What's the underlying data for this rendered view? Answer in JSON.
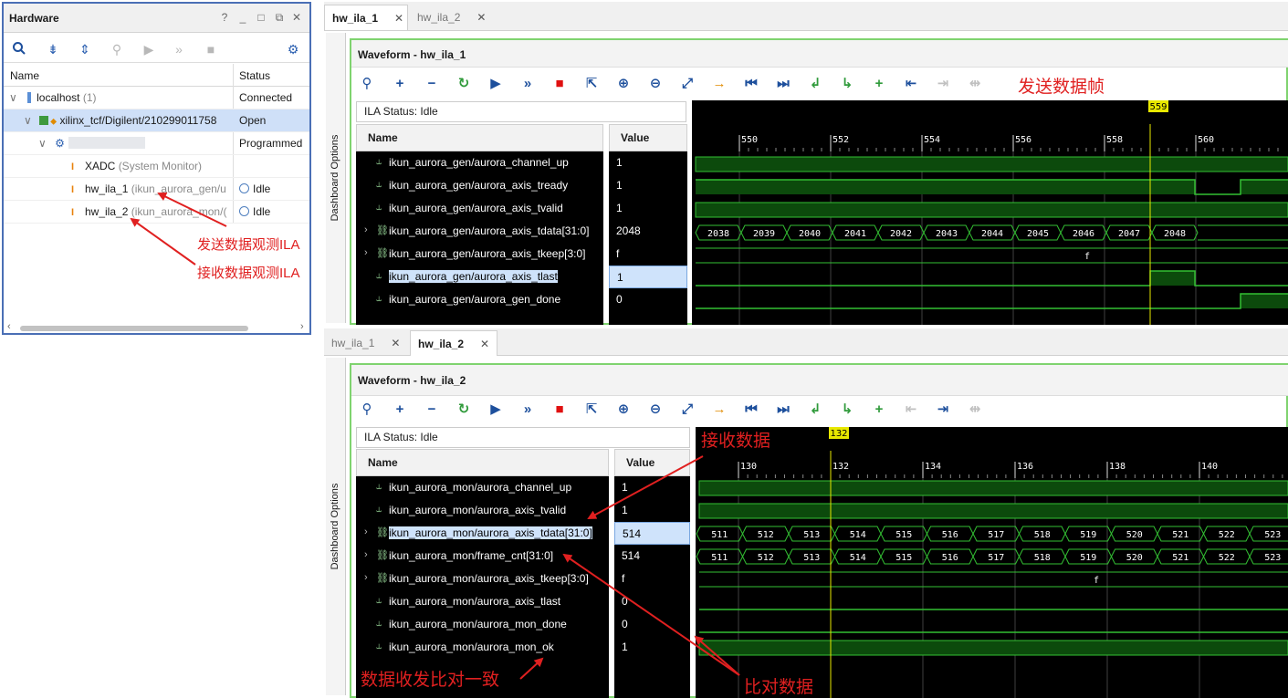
{
  "hardware": {
    "title": "Hardware",
    "header_buttons": [
      "?",
      "_",
      "□",
      "⧉",
      "✕"
    ],
    "columns": {
      "name": "Name",
      "status": "Status"
    },
    "rows": [
      {
        "name": "localhost",
        "suffix": "(1)",
        "status": "Connected"
      },
      {
        "name": "xilinx_tcf/Digilent/210299011758",
        "suffix": "",
        "status": "Open"
      },
      {
        "name": "",
        "suffix": "",
        "status": "Programmed"
      },
      {
        "name": "XADC",
        "suffix": "(System Monitor)",
        "status": ""
      },
      {
        "name": "hw_ila_1",
        "suffix": "(ikun_aurora_gen/u",
        "status": "Idle"
      },
      {
        "name": "hw_ila_2",
        "suffix": "(ikun_aurora_mon/(",
        "status": "Idle"
      }
    ]
  },
  "annotations": {
    "send_ila": "发送数据观测ILA",
    "recv_ila": "接收数据观测ILA",
    "send_frame": "发送数据帧",
    "recv_data": "接收数据",
    "compare_ok": "数据收发比对一致",
    "compare_data": "比对数据"
  },
  "top": {
    "tabs": [
      {
        "label": "hw_ila_1",
        "active": true
      },
      {
        "label": "hw_ila_2",
        "active": false
      }
    ],
    "dashboard_label": "Dashboard Options",
    "title": "Waveform - hw_ila_1",
    "ila_status": "ILA Status:  Idle",
    "name_header": "Name",
    "value_header": "Value",
    "cursor": "559",
    "ticks": [
      "550",
      "552",
      "554",
      "556",
      "558",
      "560"
    ],
    "signals": [
      {
        "name": "ikun_aurora_gen/aurora_channel_up",
        "value": "1"
      },
      {
        "name": "ikun_aurora_gen/aurora_axis_tready",
        "value": "1"
      },
      {
        "name": "ikun_aurora_gen/aurora_axis_tvalid",
        "value": "1"
      },
      {
        "name": "ikun_aurora_gen/aurora_axis_tdata[31:0]",
        "value": "2048"
      },
      {
        "name": "ikun_aurora_gen/aurora_axis_tkeep[3:0]",
        "value": "f"
      },
      {
        "name": "ikun_aurora_gen/aurora_axis_tlast",
        "value": "1"
      },
      {
        "name": "ikun_aurora_gen/aurora_gen_done",
        "value": "0"
      }
    ],
    "bus_values": [
      "2038",
      "2039",
      "2040",
      "2041",
      "2042",
      "2043",
      "2044",
      "2045",
      "2046",
      "2047",
      "2048"
    ],
    "tkeep_value": "f"
  },
  "bottom": {
    "tabs": [
      {
        "label": "hw_ila_1",
        "active": false
      },
      {
        "label": "hw_ila_2",
        "active": true
      }
    ],
    "dashboard_label": "Dashboard Options",
    "title": "Waveform - hw_ila_2",
    "ila_status": "ILA Status:  Idle",
    "name_header": "Name",
    "value_header": "Value",
    "cursor": "132",
    "ticks": [
      "130",
      "132",
      "134",
      "136",
      "138",
      "140"
    ],
    "signals": [
      {
        "name": "ikun_aurora_mon/aurora_channel_up",
        "value": "1"
      },
      {
        "name": "ikun_aurora_mon/aurora_axis_tvalid",
        "value": "1"
      },
      {
        "name": "ikun_aurora_mon/aurora_axis_tdata[31:0]",
        "value": "514"
      },
      {
        "name": "ikun_aurora_mon/frame_cnt[31:0]",
        "value": "514"
      },
      {
        "name": "ikun_aurora_mon/aurora_axis_tkeep[3:0]",
        "value": "f"
      },
      {
        "name": "ikun_aurora_mon/aurora_axis_tlast",
        "value": "0"
      },
      {
        "name": "ikun_aurora_mon/aurora_mon_done",
        "value": "0"
      },
      {
        "name": "ikun_aurora_mon/aurora_mon_ok",
        "value": "1"
      }
    ],
    "bus_values": [
      "511",
      "512",
      "513",
      "514",
      "515",
      "516",
      "517",
      "518",
      "519",
      "520",
      "521",
      "522",
      "523"
    ],
    "tkeep_value": "f"
  }
}
